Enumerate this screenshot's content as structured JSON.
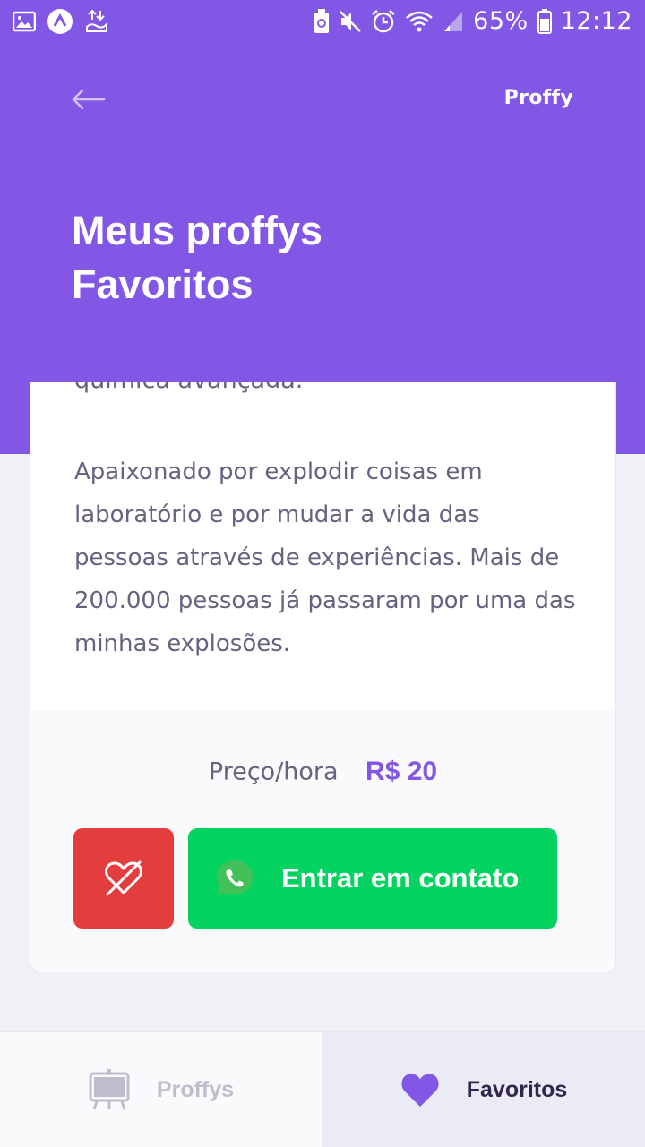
{
  "status_bar": {
    "battery": "65%",
    "time": "12:12",
    "icons": [
      "image-icon",
      "app-icon",
      "data-transfer-icon",
      "battery-saver-icon",
      "mute-icon",
      "alarm-icon",
      "wifi-icon",
      "signal-icon",
      "battery-icon"
    ]
  },
  "header": {
    "back_icon": "arrow-left-icon",
    "brand": "Proffy",
    "title_line1": "Meus proffys",
    "title_line2": "Favoritos"
  },
  "card": {
    "bio_previous_line": "química avançada.",
    "bio": "Apaixonado por explodir coisas em laboratório e por mudar a vida das pessoas através de experiências. Mais de 200.000 pessoas já passaram por uma das minhas explosões.",
    "price_label": "Preço/hora",
    "price_value": "R$ 20",
    "unfavorite_icon": "heart-outline-broken-icon",
    "contact_icon": "whatsapp-icon",
    "contact_label": "Entrar em contato"
  },
  "tabs": [
    {
      "label": "Proffys",
      "icon": "easel-icon",
      "active": false
    },
    {
      "label": "Favoritos",
      "icon": "heart-icon",
      "active": true
    }
  ],
  "colors": {
    "primary": "#8257E5",
    "danger": "#E33D3D",
    "success": "#04D361",
    "text_base": "#6A6180",
    "text_title": "#32264D",
    "text_inactive": "#C1BCCC"
  }
}
